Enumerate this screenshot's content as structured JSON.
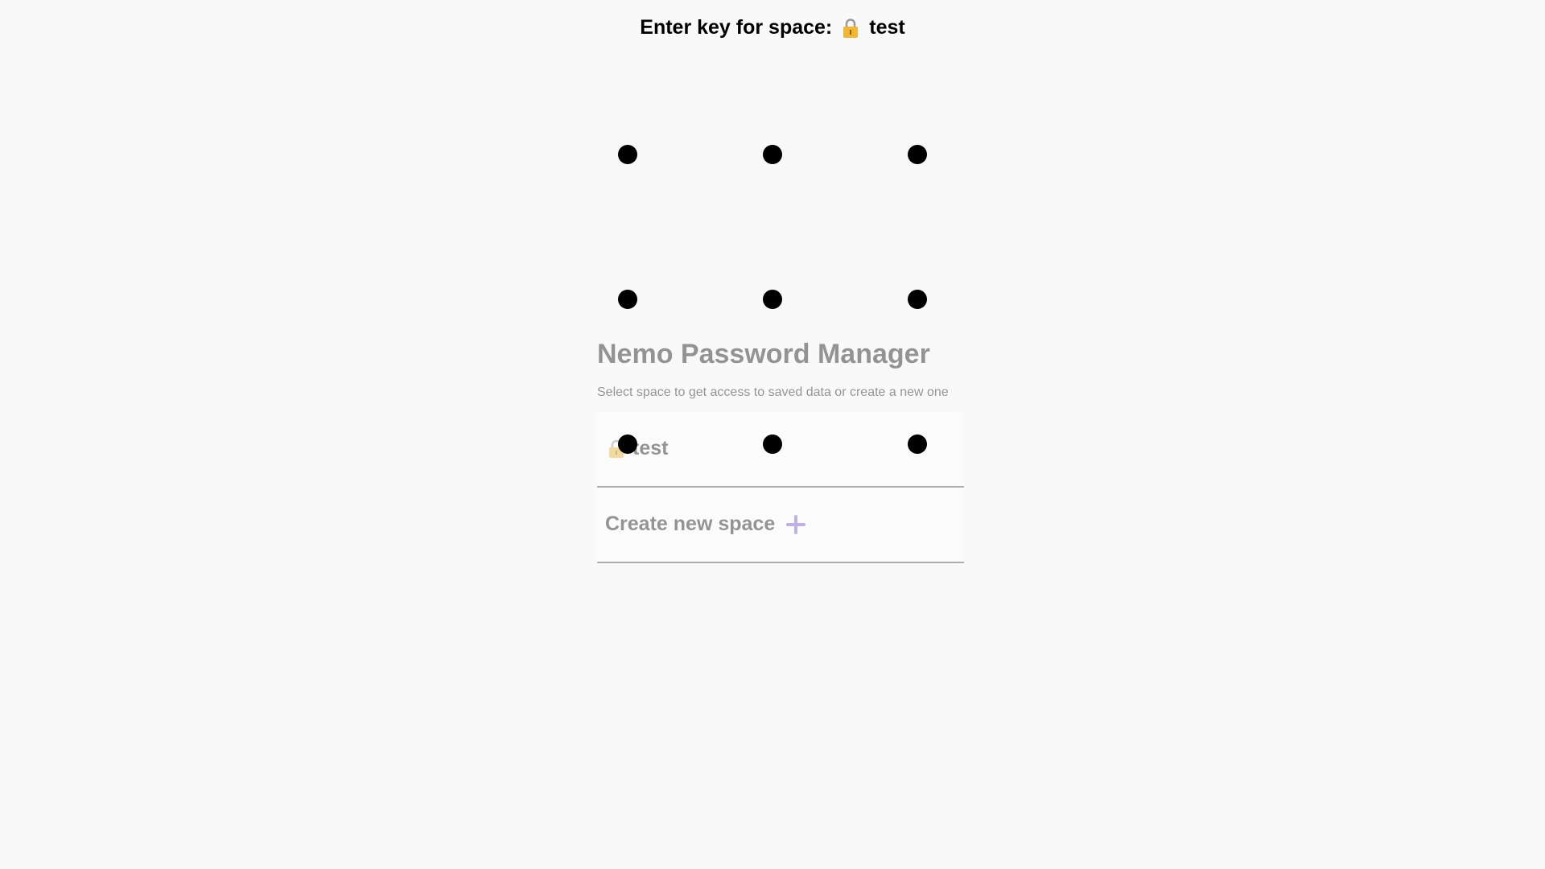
{
  "key_prompt": {
    "label": "Enter key for space:",
    "space_name": "test",
    "icon": "lock-icon"
  },
  "pattern": {
    "rows": 3,
    "cols": 3,
    "dot_color": "#000000"
  },
  "background_page": {
    "title": "Nemo Password Manager",
    "subtitle": "Select space to get access to saved data or create a new one",
    "spaces": [
      {
        "name": "test",
        "icon": "lock-icon"
      }
    ],
    "create_label": "Create new space",
    "create_icon": "plus-icon",
    "accent_color": "#7a5ccf"
  }
}
